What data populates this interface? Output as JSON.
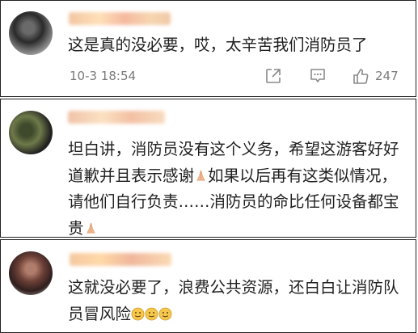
{
  "comments": [
    {
      "text": "这是真的没必要，哎，太辛苦我们消防员了",
      "date": "10-3 18:54",
      "likes": "247",
      "icons": [
        "share-icon",
        "comment-icon",
        "like-icon"
      ]
    },
    {
      "text_parts": [
        "坦白讲，消防员没有这个义务，希望这游客好好道歉并且表示感谢",
        "如果以后再有这类似情况，请他们自行负责……消防员的命比任何设备都宝贵"
      ],
      "emoji": "folded-hands-emoji"
    },
    {
      "text": "这就没必要了，浪费公共资源，还白白让消防队员冒风险",
      "emoji": "smiley-emoji",
      "emoji_count": 3
    }
  ],
  "colors": {
    "text": "#1f1f1f",
    "meta": "#7a7a7a",
    "border": "#222222",
    "emoji_yellow": "#f5c84c",
    "hands": "#f2b98f"
  }
}
